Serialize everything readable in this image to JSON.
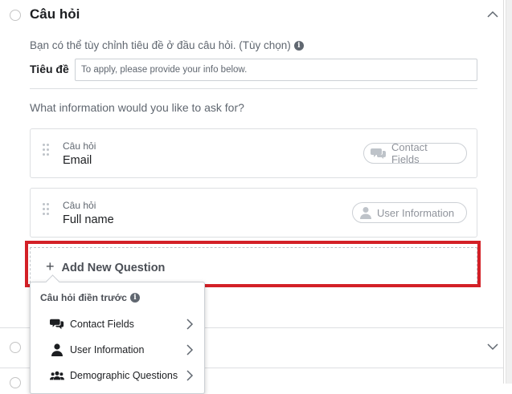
{
  "section": {
    "title": "Câu hỏi"
  },
  "intro": {
    "hint": "Bạn có thể tùy chỉnh tiêu đề ở đầu câu hỏi. (Tùy chọn)",
    "title_label": "Tiêu đề",
    "title_placeholder": "To apply, please provide your info below."
  },
  "ask_label": "What information would you like to ask for?",
  "questions": [
    {
      "small_label": "Câu hỏi",
      "value": "Email",
      "type_label": "Contact Fields",
      "type_icon": "chat-bubbles-icon"
    },
    {
      "small_label": "Câu hỏi",
      "value": "Full name",
      "type_label": "User Information",
      "type_icon": "person-icon"
    }
  ],
  "add_question_label": "Add New Question",
  "prefill_menu": {
    "header": "Câu hỏi điền trước",
    "items": [
      {
        "label": "Contact Fields",
        "icon": "chat-bubbles-icon"
      },
      {
        "label": "User Information",
        "icon": "person-icon"
      },
      {
        "label": "Demographic Questions",
        "icon": "group-icon"
      }
    ]
  },
  "colors": {
    "highlight": "#d32027",
    "muted_text": "#606770",
    "border": "#dddfe2"
  }
}
